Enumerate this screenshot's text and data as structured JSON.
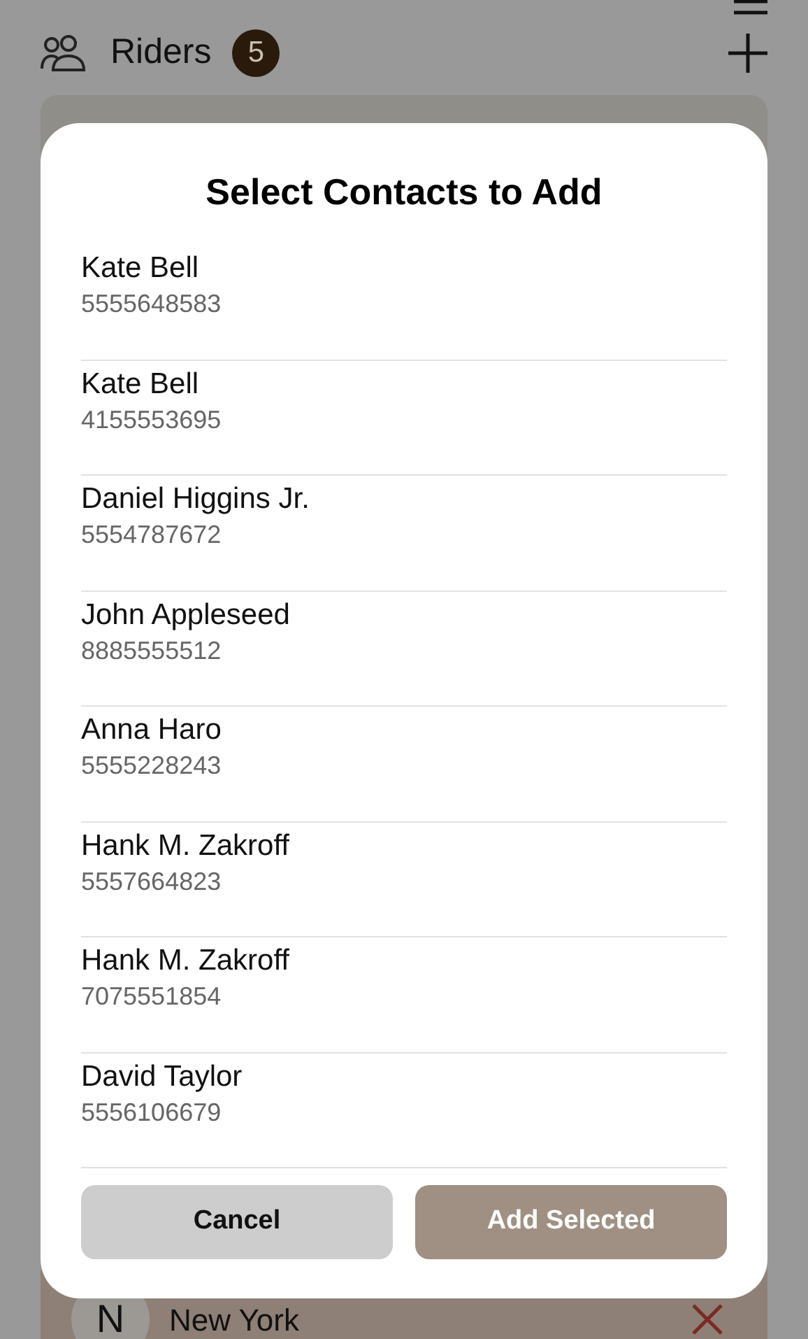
{
  "header": {
    "title": "Riders",
    "count": "5"
  },
  "background_row": {
    "avatar_letter": "N",
    "name": "New York"
  },
  "dialog": {
    "title": "Select Contacts to Add",
    "contacts": [
      {
        "name": "Kate Bell",
        "phone": "5555648583"
      },
      {
        "name": "Kate Bell",
        "phone": "4155553695"
      },
      {
        "name": "Daniel Higgins Jr.",
        "phone": "5554787672"
      },
      {
        "name": "John Appleseed",
        "phone": "8885555512"
      },
      {
        "name": "Anna Haro",
        "phone": "5555228243"
      },
      {
        "name": "Hank M. Zakroff",
        "phone": "5557664823"
      },
      {
        "name": "Hank M. Zakroff",
        "phone": "7075551854"
      },
      {
        "name": "David Taylor",
        "phone": "5556106679"
      }
    ],
    "buttons": [
      {
        "label": "Cancel",
        "kind": "secondary"
      },
      {
        "label": "Add Selected",
        "kind": "primary"
      }
    ]
  }
}
